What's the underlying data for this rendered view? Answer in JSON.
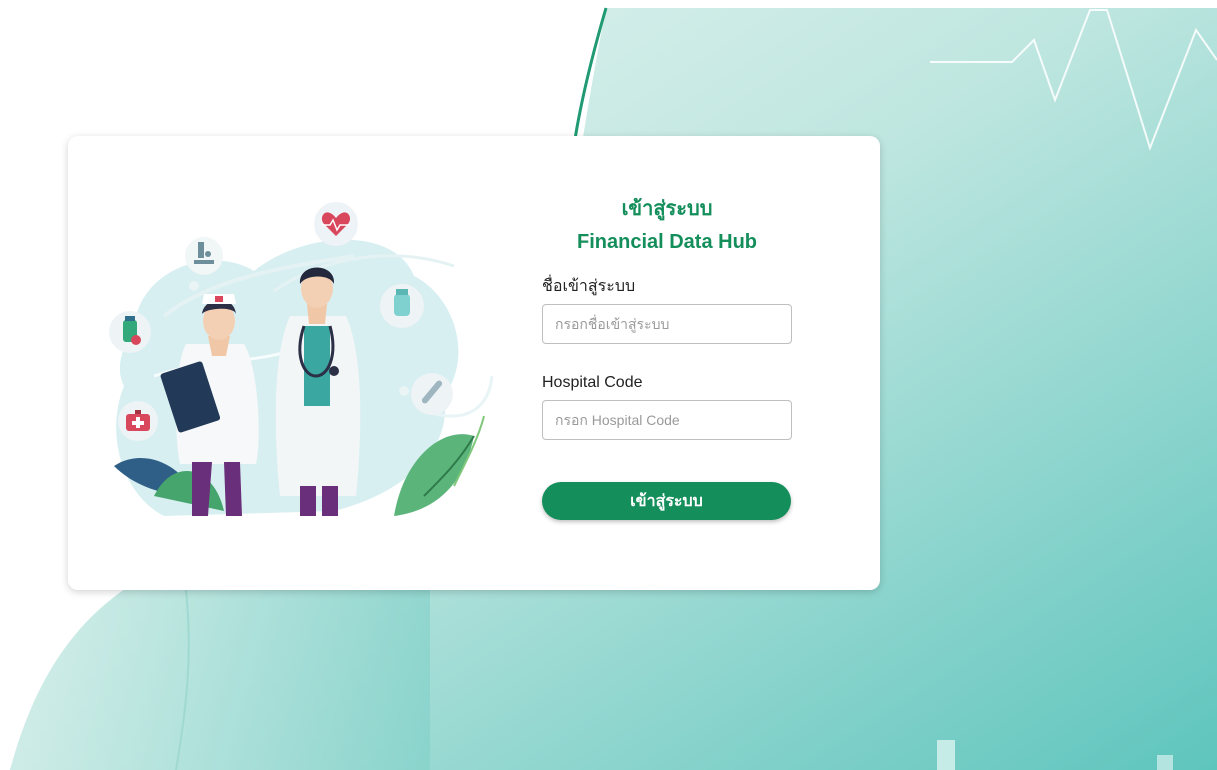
{
  "login": {
    "title": "เข้าสู่ระบบ",
    "app_name": "Financial Data Hub",
    "username_label": "ชื่อเข้าสู่ระบบ",
    "username_placeholder": "กรอกชื่อเข้าสู่ระบบ",
    "username_value": "",
    "hospital_code_label": "Hospital Code",
    "hospital_code_placeholder": "กรอก Hospital Code",
    "hospital_code_value": "",
    "submit_label": "เข้าสู่ระบบ"
  },
  "illustration": {
    "icons": [
      "microscope-icon",
      "heart-rate-icon",
      "medicine-bottle-icon",
      "pill-bottle-icon",
      "first-aid-kit-icon",
      "thermometer-icon",
      "clipboard-icon",
      "stethoscope-icon"
    ]
  },
  "colors": {
    "brand_green": "#148f5c",
    "background_teal": "#5ec5bd",
    "card_background": "#ffffff"
  }
}
